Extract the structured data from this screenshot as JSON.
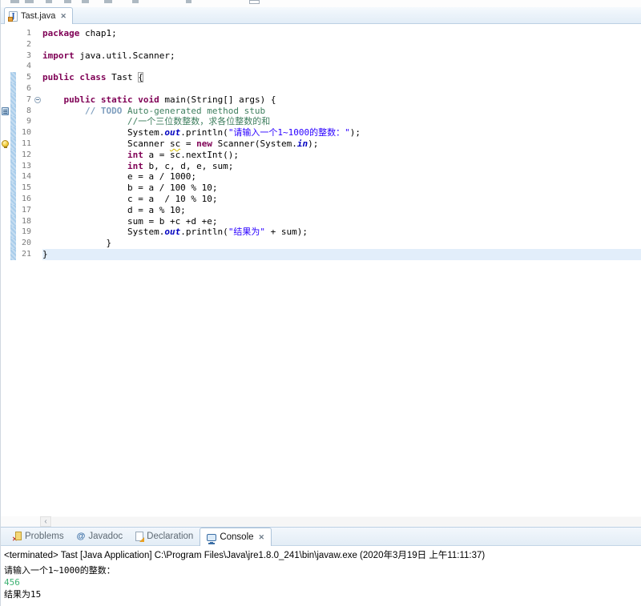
{
  "editor_tab": {
    "title": "Tast.java",
    "close": "✕",
    "icon": "java-file"
  },
  "hscroll": {
    "left_arrow": "‹"
  },
  "colors": {
    "keyword": "#7f0055",
    "comment": "#3f7f5f",
    "todo_tag": "#7f9fbf",
    "string": "#2a00ff",
    "static_field": "#0000c0",
    "diff_bar": "#a9cdeb",
    "current_line": "#e2eefa",
    "stdin_green": "#3eb273"
  },
  "editor": {
    "lines": [
      {
        "n": 1,
        "segs": [
          {
            "c": "kw",
            "t": "package"
          },
          {
            "c": "pln",
            "t": " chap1;"
          }
        ]
      },
      {
        "n": 2,
        "segs": []
      },
      {
        "n": 3,
        "segs": [
          {
            "c": "kw",
            "t": "import"
          },
          {
            "c": "pln",
            "t": " java.util.Scanner;"
          }
        ]
      },
      {
        "n": 4,
        "segs": []
      },
      {
        "n": 5,
        "diff": true,
        "segs": [
          {
            "c": "kw",
            "t": "public"
          },
          {
            "c": "pln",
            "t": " "
          },
          {
            "c": "kw",
            "t": "class"
          },
          {
            "c": "pln",
            "t": " Tast "
          },
          {
            "c": "brk pln",
            "t": "{"
          }
        ]
      },
      {
        "n": 6,
        "diff": true,
        "segs": []
      },
      {
        "n": 7,
        "diff": true,
        "fold": "collapse",
        "segs": [
          {
            "c": "pln",
            "t": "    "
          },
          {
            "c": "kw",
            "t": "public"
          },
          {
            "c": "pln",
            "t": " "
          },
          {
            "c": "kw",
            "t": "static"
          },
          {
            "c": "pln",
            "t": " "
          },
          {
            "c": "kw",
            "t": "void"
          },
          {
            "c": "pln",
            "t": " main(String[] args) {"
          }
        ]
      },
      {
        "n": 8,
        "diff": true,
        "icon": "task",
        "segs": [
          {
            "c": "pln",
            "t": "        "
          },
          {
            "c": "todo",
            "t": "// TODO"
          },
          {
            "c": "com",
            "t": " Auto-generated method stub"
          }
        ]
      },
      {
        "n": 9,
        "diff": true,
        "segs": [
          {
            "c": "pln",
            "t": "                "
          },
          {
            "c": "com",
            "t": "//一个三位数整数，求各位整数的和"
          }
        ]
      },
      {
        "n": 10,
        "diff": true,
        "segs": [
          {
            "c": "pln",
            "t": "                System."
          },
          {
            "c": "fld",
            "t": "out"
          },
          {
            "c": "pln",
            "t": ".println("
          },
          {
            "c": "str",
            "t": "\"请输入一个1~1000的整数：\""
          },
          {
            "c": "pln",
            "t": ");"
          }
        ]
      },
      {
        "n": 11,
        "diff": true,
        "icon": "bulb",
        "segs": [
          {
            "c": "pln",
            "t": "                Scanner "
          },
          {
            "c": "warn",
            "t": "sc"
          },
          {
            "c": "pln",
            "t": " = "
          },
          {
            "c": "kw",
            "t": "new"
          },
          {
            "c": "pln",
            "t": " Scanner(System."
          },
          {
            "c": "fld",
            "t": "in"
          },
          {
            "c": "pln",
            "t": ");"
          }
        ]
      },
      {
        "n": 12,
        "diff": true,
        "segs": [
          {
            "c": "pln",
            "t": "                "
          },
          {
            "c": "kw",
            "t": "int"
          },
          {
            "c": "pln",
            "t": " a = sc.nextInt();"
          }
        ]
      },
      {
        "n": 13,
        "diff": true,
        "segs": [
          {
            "c": "pln",
            "t": "                "
          },
          {
            "c": "kw",
            "t": "int"
          },
          {
            "c": "pln",
            "t": " b, c, d, e, sum;"
          }
        ]
      },
      {
        "n": 14,
        "diff": true,
        "segs": [
          {
            "c": "pln",
            "t": "                e = a / 1000;"
          }
        ]
      },
      {
        "n": 15,
        "diff": true,
        "segs": [
          {
            "c": "pln",
            "t": "                b = a / 100 % 10;"
          }
        ]
      },
      {
        "n": 16,
        "diff": true,
        "segs": [
          {
            "c": "pln",
            "t": "                c = a  / 10 % 10;"
          }
        ]
      },
      {
        "n": 17,
        "diff": true,
        "segs": [
          {
            "c": "pln",
            "t": "                d = a % 10;"
          }
        ]
      },
      {
        "n": 18,
        "diff": true,
        "segs": [
          {
            "c": "pln",
            "t": "                sum = b +c +d +e;"
          }
        ]
      },
      {
        "n": 19,
        "diff": true,
        "segs": [
          {
            "c": "pln",
            "t": "                System."
          },
          {
            "c": "fld",
            "t": "out"
          },
          {
            "c": "pln",
            "t": ".println("
          },
          {
            "c": "str",
            "t": "\"结果为\""
          },
          {
            "c": "pln",
            "t": " + sum);"
          }
        ]
      },
      {
        "n": 20,
        "diff": true,
        "segs": [
          {
            "c": "pln",
            "t": "            }"
          }
        ]
      },
      {
        "n": 21,
        "diff": true,
        "highlight": true,
        "segs": [
          {
            "c": "pln",
            "t": "}"
          }
        ]
      }
    ]
  },
  "bottom_panel": {
    "tabs": [
      {
        "label": "Problems",
        "icon": "problems",
        "active": false
      },
      {
        "label": "Javadoc",
        "icon": "javadoc",
        "active": false
      },
      {
        "label": "Declaration",
        "icon": "declaration",
        "active": false
      },
      {
        "label": "Console",
        "icon": "console",
        "active": true,
        "close": "✕"
      }
    ],
    "status": "<terminated> Tast [Java Application] C:\\Program Files\\Java\\jre1.8.0_241\\bin\\javaw.exe (2020年3月19日 上午11:11:37)",
    "output": [
      {
        "text": "请输入一个1~1000的整数：",
        "color": "#000000",
        "kind": "stdout"
      },
      {
        "text": "456",
        "color": "#3eb273",
        "kind": "stdin"
      },
      {
        "text": "结果为15",
        "color": "#000000",
        "kind": "stdout"
      }
    ]
  }
}
